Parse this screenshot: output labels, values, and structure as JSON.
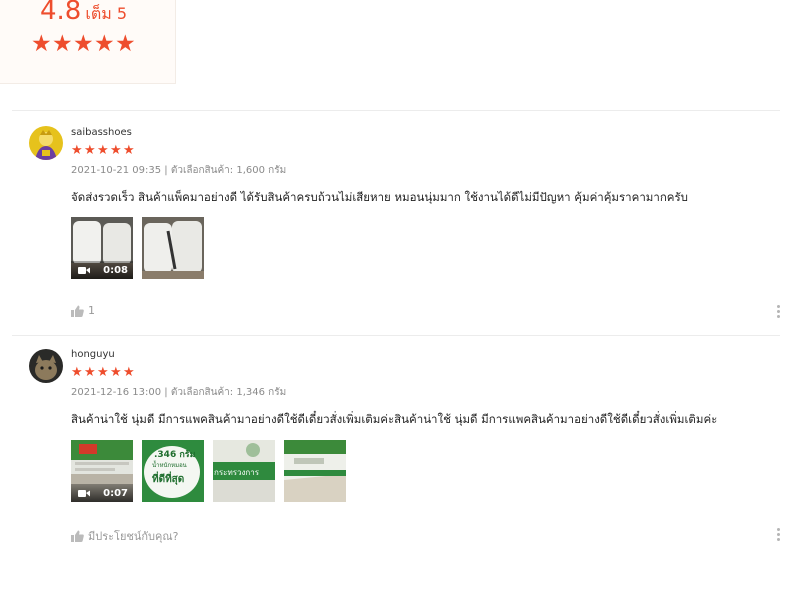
{
  "summary": {
    "score": "4.8",
    "out_of": "เต็ม 5",
    "stars": 5,
    "accent_color": "#ee4d2d"
  },
  "reviews": [
    {
      "username": "saibasshoes",
      "stars": 5,
      "meta": "2021-10-21 09:35 | ตัวเลือกสินค้า: 1,600 กรัม",
      "text": "จัดส่งรวดเร็ว สินค้าแพ็คมาอย่างดี ได้รับสินค้าครบถ้วนไม่เสียหาย หมอนนุ่มมาก ใช้งานได้ดีไม่มีปัญหา คุ้มค่าคุ้มราคามากครับ",
      "media": [
        {
          "type": "video",
          "duration": "0:08",
          "icon": "video-camera-icon"
        },
        {
          "type": "image"
        }
      ],
      "like_count": "1"
    },
    {
      "username": "honguyu",
      "stars": 5,
      "meta": "2021-12-16 13:00 | ตัวเลือกสินค้า: 1,346 กรัม",
      "text": "สินค้าน่าใช้ นุ่มดี มีการแพคสินค้ามาอย่างดีใช้ดีเดี๋ยวสั่งเพิ่มเติมค่ะสินค้าน่าใช้ นุ่มดี มีการแพคสินค้ามาอย่างดีใช้ดีเดี๋ยวสั่งเพิ่มเติมค่ะ",
      "media": [
        {
          "type": "video",
          "duration": "0:07",
          "icon": "video-camera-icon"
        },
        {
          "type": "image",
          "text_line1": ".346 กรัม",
          "text_line2": "น้ำหนักหมอน",
          "text_line3": "ที่ดีที่สุด"
        },
        {
          "type": "image",
          "text_line1": "กระทรวงการ"
        },
        {
          "type": "image"
        }
      ],
      "helpful_label": "มีประโยชน์กับคุณ?"
    }
  ]
}
